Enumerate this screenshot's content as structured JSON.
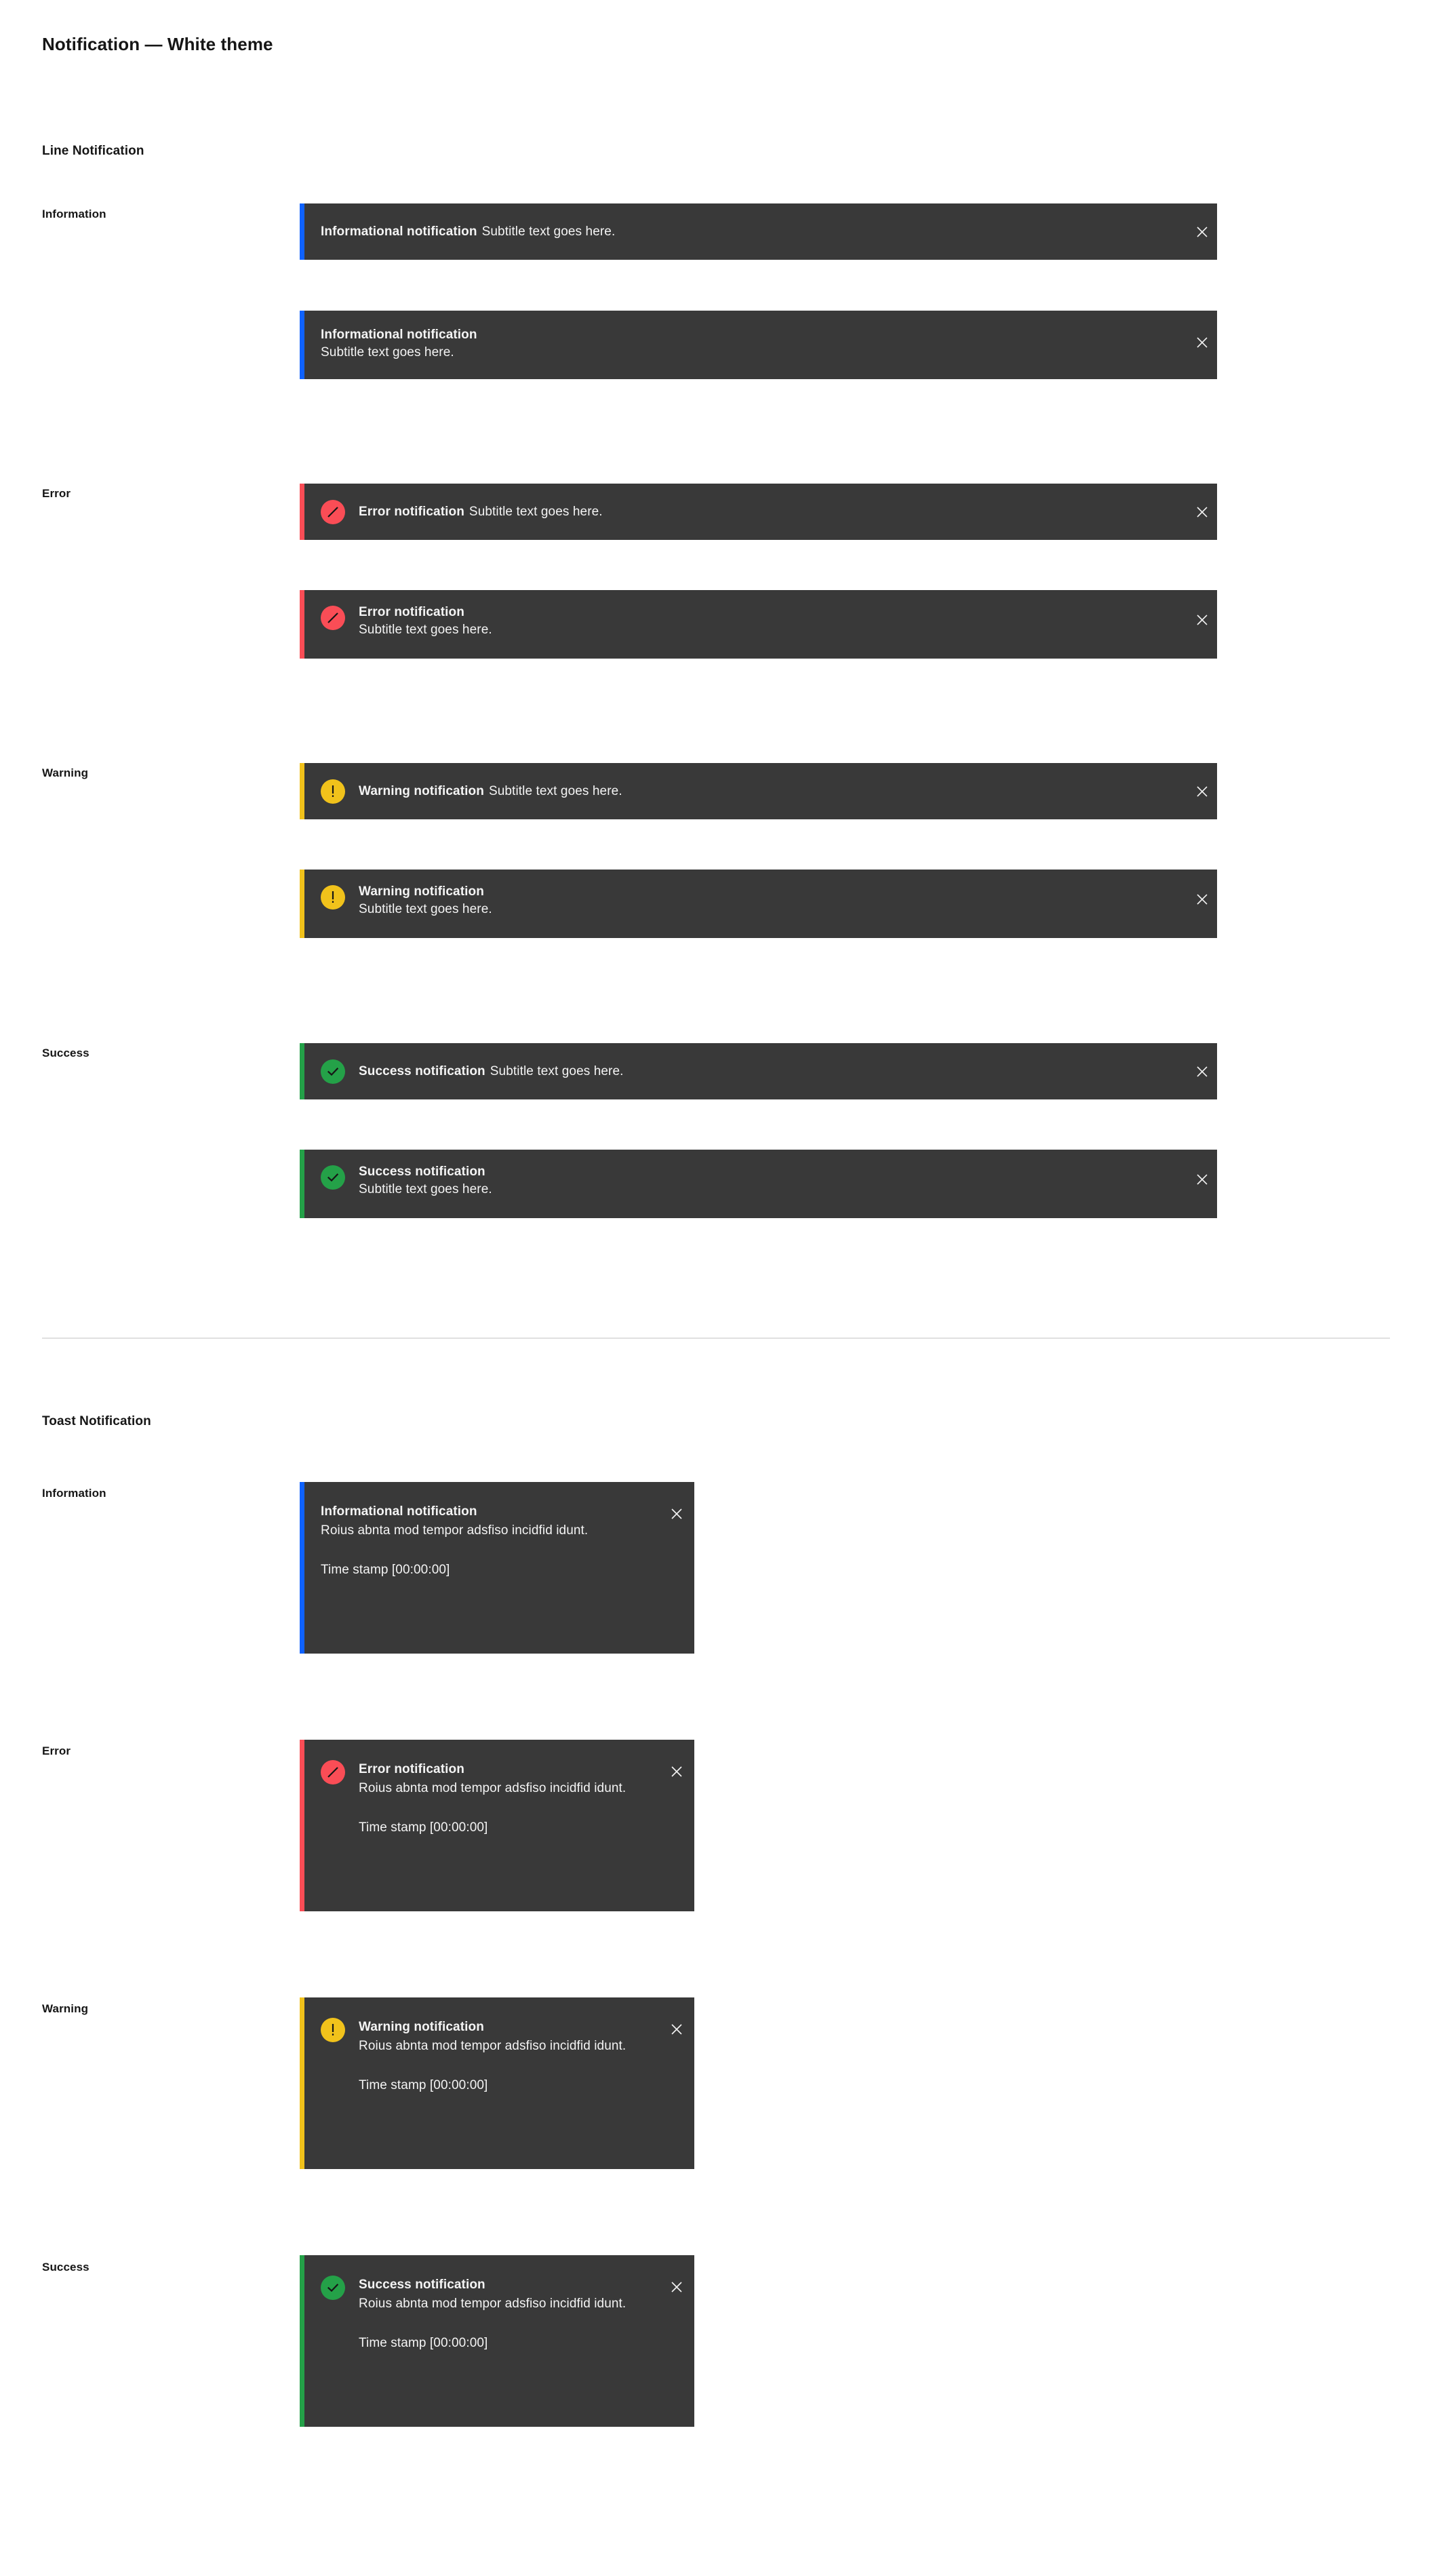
{
  "page": {
    "title": "Notification — White theme"
  },
  "colors": {
    "background": "#ffffff",
    "notification_bg": "#393939",
    "text_primary": "#161616",
    "text_on_dark": "#f4f4f4",
    "divider": "#e0e0e0",
    "info": "#0f62fe",
    "error": "#fa4d56",
    "warning": "#f1c21b",
    "success": "#24a148",
    "icon_glyph_dark": "#161616"
  },
  "sections": [
    {
      "id": "line-notification",
      "heading": "Line Notification",
      "categories": [
        {
          "id": "information",
          "label": "Information"
        },
        {
          "id": "error",
          "label": "Error"
        },
        {
          "id": "warning",
          "label": "Warning"
        },
        {
          "id": "success",
          "label": "Success"
        }
      ]
    },
    {
      "id": "toast-notification",
      "heading": "Toast Notification",
      "categories": [
        {
          "id": "information",
          "label": "Information"
        },
        {
          "id": "error",
          "label": "Error"
        },
        {
          "id": "warning",
          "label": "Warning"
        },
        {
          "id": "success",
          "label": "Success"
        }
      ]
    }
  ],
  "line_notifications": [
    {
      "id": "info-inline",
      "kind": "information",
      "variant": "inline",
      "icon": "none",
      "title": "Informational notification",
      "subtitle": "Subtitle text goes here.",
      "close_label": "close-icon"
    },
    {
      "id": "info-stacked",
      "kind": "information",
      "variant": "stacked",
      "icon": "none",
      "title": "Informational notification",
      "subtitle": "Subtitle text goes here.",
      "close_label": "close-icon"
    },
    {
      "id": "error-inline",
      "kind": "error",
      "variant": "inline",
      "icon": "error-circle-slash-icon",
      "title": "Error notification",
      "subtitle": "Subtitle text goes here.",
      "close_label": "close-icon"
    },
    {
      "id": "error-stacked",
      "kind": "error",
      "variant": "stacked",
      "icon": "error-circle-slash-icon",
      "title": "Error notification",
      "subtitle": "Subtitle text goes here.",
      "close_label": "close-icon"
    },
    {
      "id": "warning-inline",
      "kind": "warning",
      "variant": "inline",
      "icon": "warning-exclamation-icon",
      "title": "Warning notification",
      "subtitle": "Subtitle text goes here.",
      "close_label": "close-icon"
    },
    {
      "id": "warning-stacked",
      "kind": "warning",
      "variant": "stacked",
      "icon": "warning-exclamation-icon",
      "title": "Warning notification",
      "subtitle": "Subtitle text goes here.",
      "close_label": "close-icon"
    },
    {
      "id": "success-inline",
      "kind": "success",
      "variant": "inline",
      "icon": "success-checkmark-icon",
      "title": "Success notification",
      "subtitle": "Subtitle text goes here.",
      "close_label": "close-icon"
    },
    {
      "id": "success-stacked",
      "kind": "success",
      "variant": "stacked",
      "icon": "success-checkmark-icon",
      "title": "Success notification",
      "subtitle": "Subtitle text goes here.",
      "close_label": "close-icon"
    }
  ],
  "toast_notifications": [
    {
      "id": "toast-info",
      "kind": "information",
      "icon": "none",
      "title": "Informational notification",
      "body": "Roius abnta mod tempor adsfiso incidfid idunt.",
      "timestamp": "Time stamp [00:00:00]",
      "close_label": "close-icon"
    },
    {
      "id": "toast-error",
      "kind": "error",
      "icon": "error-circle-slash-icon",
      "title": "Error notification",
      "body": "Roius abnta mod tempor adsfiso incidfid idunt.",
      "timestamp": "Time stamp [00:00:00]",
      "close_label": "close-icon"
    },
    {
      "id": "toast-warning",
      "kind": "warning",
      "icon": "warning-exclamation-icon",
      "title": "Warning notification",
      "body": "Roius abnta mod tempor adsfiso incidfid idunt.",
      "timestamp": "Time stamp [00:00:00]",
      "close_label": "close-icon"
    },
    {
      "id": "toast-success",
      "kind": "success",
      "icon": "success-checkmark-icon",
      "title": "Success notification",
      "body": "Roius abnta mod tempor adsfiso incidfid idunt.",
      "timestamp": "Time stamp [00:00:00]",
      "close_label": "close-icon"
    }
  ]
}
